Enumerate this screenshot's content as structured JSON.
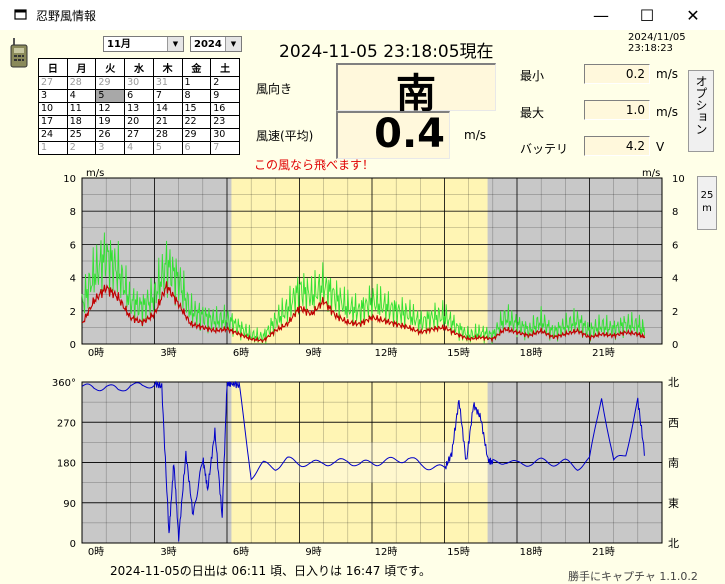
{
  "window": {
    "title": "忍野風情報",
    "min_glyph": "—",
    "max_glyph": "☐",
    "close_glyph": "✕"
  },
  "calendar": {
    "month": "11月",
    "year": "2024",
    "weekdays": [
      "日",
      "月",
      "火",
      "水",
      "木",
      "金",
      "土"
    ],
    "rows": [
      [
        "27",
        "28",
        "29",
        "30",
        "31",
        "1",
        "2"
      ],
      [
        "3",
        "4",
        "5",
        "6",
        "7",
        "8",
        "9"
      ],
      [
        "10",
        "11",
        "12",
        "13",
        "14",
        "15",
        "16"
      ],
      [
        "17",
        "18",
        "19",
        "20",
        "21",
        "22",
        "23"
      ],
      [
        "24",
        "25",
        "26",
        "27",
        "28",
        "29",
        "30"
      ],
      [
        "1",
        "2",
        "3",
        "4",
        "5",
        "6",
        "7"
      ]
    ]
  },
  "header": {
    "current": "2024-11-05 23:18:05現在",
    "date": "2024/11/05",
    "time": "23:18:23"
  },
  "readings": {
    "direction_label": "風向き",
    "direction": "南",
    "speed_label": "風速(平均)",
    "speed": "0.4",
    "speed_unit": "m/s",
    "min_label": "最小",
    "min": "0.2",
    "max_label": "最大",
    "max": "1.0",
    "battery_label": "バッテリ",
    "battery": "4.2",
    "battery_unit": "V",
    "unit_ms": "m/s",
    "message": "この風なら飛べます！"
  },
  "buttons": {
    "option": "オプション",
    "range_top": "25",
    "range_bottom": "m"
  },
  "footer": {
    "sun": "2024-11-05の日出は 06:11 頃、日入りは 16:47 頃です。",
    "credit": "勝手にキャプチャ 1.1.0.2"
  },
  "colors": {
    "night": "#c8c8c8",
    "day": "#fff5b4",
    "speed_avg": "#c00000",
    "speed_gust": "#33e033",
    "direction": "#0000c8"
  },
  "chart_data": [
    {
      "type": "line",
      "ylabel_left": "m/s",
      "ylabel_right": "m/s",
      "ylim": [
        0,
        10
      ],
      "yticks": [
        "0",
        "2",
        "4",
        "6",
        "8",
        "10"
      ],
      "xticks": [
        "0時",
        "3時",
        "6時",
        "9時",
        "12時",
        "15時",
        "18時",
        "21時"
      ],
      "x_hours_range": [
        0,
        24
      ],
      "grid": true,
      "series": [
        {
          "name": "",
          "x": [
            0,
            0.5,
            1,
            1.5,
            2,
            2.5,
            3,
            3.5,
            4,
            4.5,
            5,
            5.5,
            6,
            6.5,
            7,
            7.5,
            8,
            8.5,
            9,
            9.5,
            10,
            10.5,
            11,
            11.5,
            12,
            12.5,
            13,
            13.5,
            14,
            14.5,
            15,
            15.5,
            16,
            16.5,
            17,
            17.5,
            18,
            18.5,
            19,
            19.5,
            20,
            20.5,
            21,
            21.5,
            22,
            22.5,
            23,
            23.3
          ],
          "values": [
            1.2,
            2.6,
            3.4,
            2.8,
            1.6,
            1.3,
            1.8,
            3.5,
            2.4,
            1.2,
            1.0,
            0.8,
            0.9,
            0.6,
            0.3,
            0.2,
            0.8,
            1.2,
            2.2,
            1.8,
            2.6,
            1.7,
            1.3,
            1.2,
            1.6,
            1.4,
            1.2,
            1.0,
            0.7,
            0.9,
            1.0,
            0.6,
            0.3,
            0.4,
            0.3,
            0.9,
            0.7,
            0.5,
            0.8,
            0.4,
            0.6,
            0.8,
            0.4,
            0.6,
            0.5,
            0.7,
            0.6,
            0.4
          ]
        },
        {
          "name": "",
          "x": [
            0,
            0.5,
            1,
            1.5,
            2,
            2.5,
            3,
            3.5,
            4,
            4.5,
            5,
            5.5,
            6,
            6.5,
            7,
            7.5,
            8,
            8.5,
            9,
            9.5,
            10,
            10.5,
            11,
            11.5,
            12,
            12.5,
            13,
            13.5,
            14,
            14.5,
            15,
            15.5,
            16,
            16.5,
            17,
            17.5,
            18,
            18.5,
            19,
            19.5,
            20,
            20.5,
            21,
            21.5,
            22,
            22.5,
            23,
            23.3
          ],
          "values": [
            2.4,
            4.2,
            5.3,
            4.4,
            2.6,
            2.2,
            2.9,
            4.8,
            3.8,
            2.0,
            1.7,
            1.4,
            1.5,
            1.0,
            0.5,
            0.4,
            1.4,
            2.1,
            3.3,
            2.9,
            3.5,
            2.8,
            2.2,
            2.0,
            2.6,
            2.3,
            2.0,
            1.8,
            1.3,
            1.6,
            1.7,
            1.0,
            0.5,
            0.7,
            0.5,
            1.6,
            1.2,
            0.8,
            1.4,
            0.7,
            1.1,
            1.4,
            0.8,
            1.1,
            0.9,
            1.2,
            1.1,
            0.8
          ]
        }
      ]
    },
    {
      "type": "line",
      "ylim": [
        0,
        360
      ],
      "yticks": [
        "0",
        "90",
        "180",
        "270",
        "360°"
      ],
      "yticks_right": [
        "北",
        "東",
        "南",
        "西",
        "北"
      ],
      "xticks": [
        "0時",
        "3時",
        "6時",
        "9時",
        "12時",
        "15時",
        "18時",
        "21時"
      ],
      "x_hours_range": [
        0,
        24
      ],
      "grid": true,
      "series": [
        {
          "name": "",
          "x": [
            0,
            0.5,
            1,
            1.5,
            2,
            2.5,
            3,
            3.3,
            3.6,
            3.8,
            4,
            4.3,
            4.6,
            5,
            5.2,
            5.5,
            5.8,
            6,
            6.2,
            6.5,
            7,
            7.5,
            8,
            8.5,
            9,
            9.5,
            10,
            10.5,
            11,
            11.5,
            12,
            12.5,
            13,
            13.5,
            14,
            14.5,
            15,
            15.3,
            15.6,
            15.9,
            16.2,
            16.5,
            16.8,
            17,
            17.5,
            18,
            18.5,
            19,
            19.5,
            20,
            20.5,
            21,
            21.5,
            22,
            22.5,
            23,
            23.3
          ],
          "values": [
            350,
            345,
            352,
            340,
            355,
            348,
            358,
            350,
            20,
            180,
            10,
            200,
            60,
            190,
            120,
            250,
            60,
            355,
            358,
            352,
            150,
            175,
            170,
            185,
            180,
            175,
            182,
            178,
            185,
            175,
            180,
            182,
            185,
            190,
            175,
            170,
            165,
            200,
            320,
            180,
            310,
            280,
            185,
            180,
            185,
            175,
            180,
            182,
            180,
            180,
            170,
            185,
            330,
            180,
            200,
            320,
            190
          ]
        }
      ]
    }
  ]
}
